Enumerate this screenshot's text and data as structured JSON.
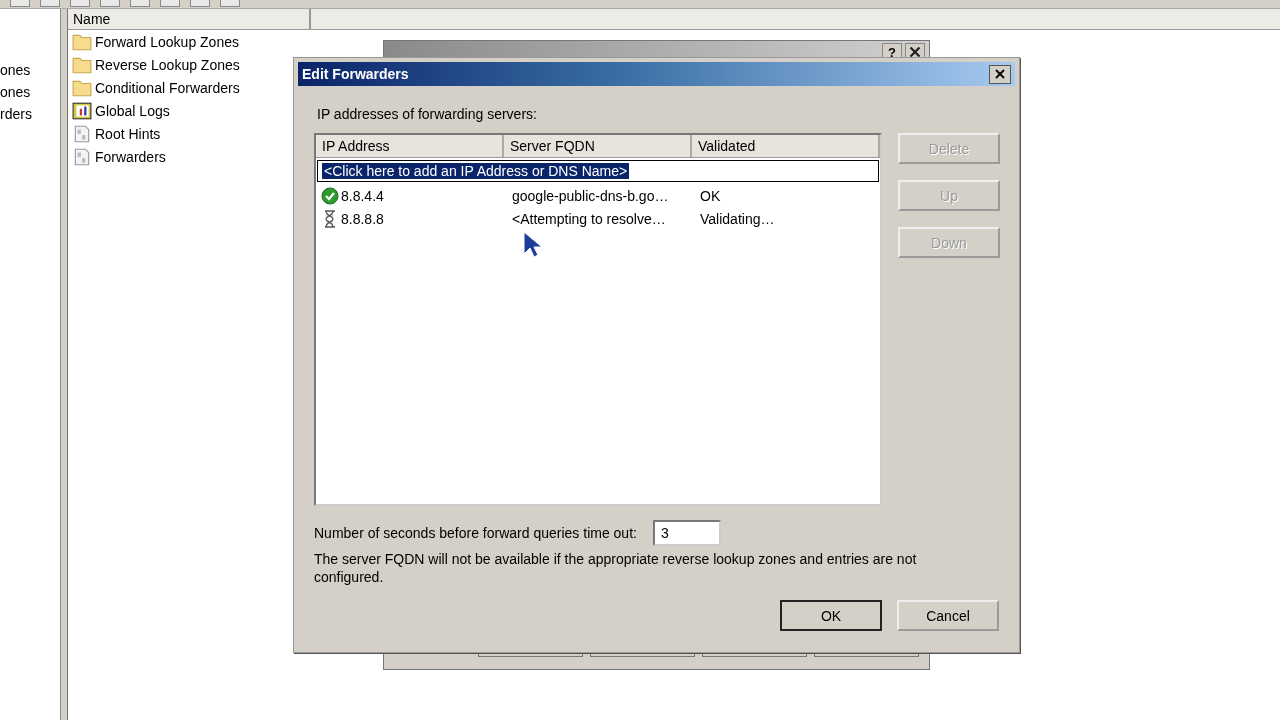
{
  "background_window": {
    "tree_items": [
      "ones",
      "ones",
      "rders"
    ],
    "list": {
      "columns": [
        "Name"
      ],
      "items": [
        {
          "label": "Forward Lookup Zones",
          "kind": "folder"
        },
        {
          "label": "Reverse Lookup Zones",
          "kind": "folder"
        },
        {
          "label": "Conditional Forwarders",
          "kind": "folder"
        },
        {
          "label": "Global Logs",
          "kind": "log"
        },
        {
          "label": "Root Hints",
          "kind": "binary"
        },
        {
          "label": "Forwarders",
          "kind": "binary"
        }
      ]
    }
  },
  "properties_window": {
    "title_buttons": [
      "?"
    ]
  },
  "dialog": {
    "title": "Edit Forwarders",
    "list_label": "IP addresses of forwarding servers:",
    "columns": [
      "IP Address",
      "Server FQDN",
      "Validated"
    ],
    "add_row": "<Click here to add an IP Address or DNS Name>",
    "rows": [
      {
        "kind": "resolved",
        "ip": "8.8.4.4",
        "fqdn": "google-public-dns-b.go…",
        "validated": "OK"
      },
      {
        "kind": "resolving",
        "ip": "8.8.8.8",
        "fqdn": "<Attempting to resolve…",
        "validated": "Validating…"
      }
    ],
    "side_buttons": [
      {
        "label": "Delete",
        "disabled": true
      },
      {
        "label": "Up",
        "disabled": true
      },
      {
        "label": "Down",
        "disabled": true
      }
    ],
    "timeout": {
      "label": "Number of seconds before forward queries time out:",
      "value": "3"
    },
    "note": "The server FQDN will not be available if the appropriate reverse lookup zones and entries are not configured.",
    "buttons": [
      {
        "label": "OK",
        "default": true
      },
      {
        "label": "Cancel",
        "default": false
      }
    ]
  }
}
